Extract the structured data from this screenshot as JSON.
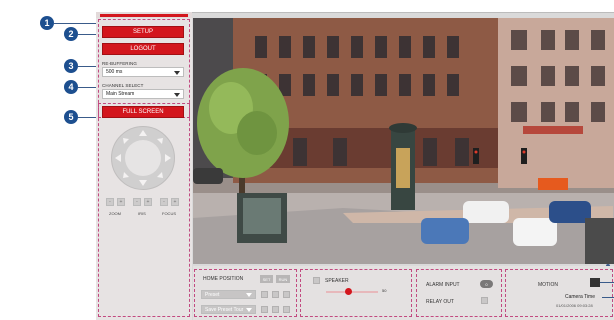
{
  "callouts": [
    "1",
    "2",
    "3",
    "4",
    "5"
  ],
  "sidebar": {
    "setup_label": "SETUP",
    "logout_label": "LOGOUT",
    "buffering": {
      "label": "RE-BUFFERING",
      "value": "500 ms"
    },
    "channel": {
      "label": "CHANNEL SELECT",
      "value": "Main Stream"
    },
    "fullscreen_label": "FULL SCREEN",
    "ptz": {
      "zoom_label": "ZOOM",
      "iris_label": "IRIS",
      "focus_label": "FOCUS",
      "minus": "-",
      "plus": "+"
    }
  },
  "bottom": {
    "home_position": {
      "title": "HOME POSITION",
      "set_label": "SET",
      "run_label": "RUN",
      "preset_value": "Preset",
      "mode_value": "Save Preset Tour"
    },
    "speaker": {
      "title": "SPEAKER",
      "value": "50"
    },
    "alarm": {
      "alarm_input_label": "ALARM INPUT",
      "alarm_input_value": "0",
      "relay_out_label": "RELAY OUT"
    },
    "motion": {
      "title": "MOTION",
      "camera_time_label": "Camera Time",
      "camera_time_value": "01/01/2006 09:03:28"
    }
  },
  "colors": {
    "accent_red": "#d3161d",
    "callout_blue": "#1d4f8f",
    "dotted_pink": "#c24a80"
  }
}
